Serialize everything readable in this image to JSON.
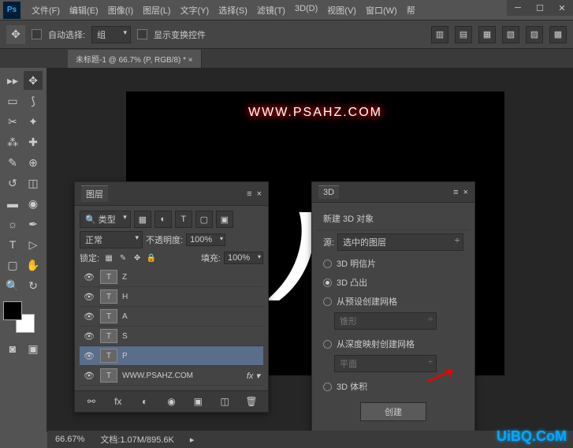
{
  "menu": {
    "items": [
      "文件(F)",
      "编辑(E)",
      "图像(I)",
      "图层(L)",
      "文字(Y)",
      "选择(S)",
      "滤镜(T)",
      "3D(D)",
      "视图(V)",
      "窗口(W)",
      "帮"
    ]
  },
  "options": {
    "auto_select": "自动选择:",
    "group": "组",
    "show_transform": "显示变换控件"
  },
  "doc": {
    "tab": "未标题-1 @ 66.7% (P, RGB/8) * ×"
  },
  "canvas": {
    "watermark": "WWW.PSAHZ.COM",
    "letter": "A"
  },
  "layers": {
    "title": "图层",
    "filter": "类型",
    "blend": "正常",
    "opacity_label": "不透明度:",
    "opacity": "100%",
    "lock_label": "锁定:",
    "fill_label": "填充:",
    "fill": "100%",
    "items": [
      {
        "thumb": "T",
        "name": "Z"
      },
      {
        "thumb": "T",
        "name": "H"
      },
      {
        "thumb": "T",
        "name": "A"
      },
      {
        "thumb": "T",
        "name": "S"
      },
      {
        "thumb": "T",
        "name": "P",
        "selected": true
      },
      {
        "thumb": "T",
        "name": "WWW.PSAHZ.COM",
        "fx": true
      }
    ]
  },
  "d3": {
    "tab": "3D",
    "header": "新建 3D 对象",
    "source_label": "源:",
    "source_value": "选中的图层",
    "options": [
      {
        "label": "3D 明信片",
        "checked": false
      },
      {
        "label": "3D 凸出",
        "checked": true
      },
      {
        "label": "从预设创建网格",
        "checked": false,
        "sub": "锥形",
        "disabled": true
      },
      {
        "label": "从深度映射创建网格",
        "checked": false,
        "sub": "平面",
        "disabled": true
      },
      {
        "label": "3D 体积",
        "checked": false
      }
    ],
    "create": "创建"
  },
  "status": {
    "zoom": "66.67%",
    "docinfo": "文档:1.07M/895.6K"
  },
  "brand": "UiBQ.CoM"
}
